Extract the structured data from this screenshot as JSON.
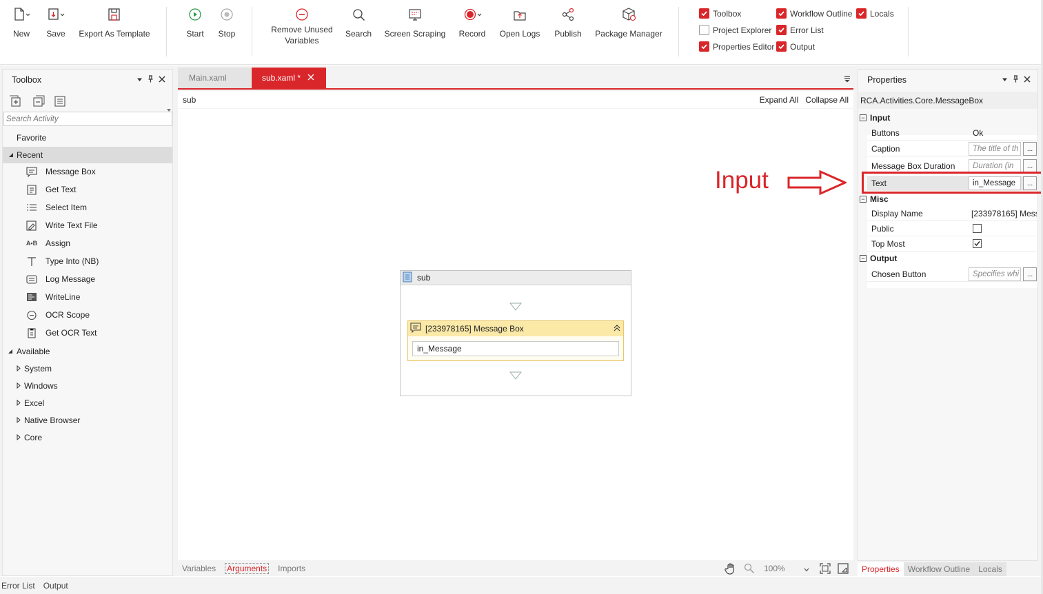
{
  "ribbon": {
    "new_label": "New",
    "save_label": "Save",
    "export_label": "Export As Template",
    "start_label": "Start",
    "stop_label": "Stop",
    "remove_unused_label_1": "Remove Unused",
    "remove_unused_label_2": "Variables",
    "search_label": "Search",
    "screen_scraping_label": "Screen Scraping",
    "record_label": "Record",
    "open_logs_label": "Open Logs",
    "publish_label": "Publish",
    "package_manager_label": "Package Manager",
    "checks": {
      "toolbox": {
        "label": "Toolbox",
        "checked": true
      },
      "workflow_outline": {
        "label": "Workflow Outline",
        "checked": true
      },
      "locals": {
        "label": "Locals",
        "checked": true
      },
      "project_explorer": {
        "label": "Project Explorer",
        "checked": false
      },
      "error_list": {
        "label": "Error List",
        "checked": true
      },
      "properties_editor": {
        "label": "Properties Editor",
        "checked": true
      },
      "output": {
        "label": "Output",
        "checked": true
      }
    }
  },
  "toolbox": {
    "title": "Toolbox",
    "search_placeholder": "Search Activity",
    "favorite": "Favorite",
    "recent": "Recent",
    "recent_items": [
      "Message Box",
      "Get Text",
      "Select Item",
      "Write Text File",
      "Assign",
      "Type Into (NB)",
      "Log Message",
      "WriteLine",
      "OCR Scope",
      "Get OCR Text"
    ],
    "available": "Available",
    "available_items": [
      "System",
      "Windows",
      "Excel",
      "Native Browser",
      "Core"
    ]
  },
  "tabs": [
    {
      "label": "Main.xaml",
      "active": false
    },
    {
      "label": "sub.xaml *",
      "active": true
    }
  ],
  "designer": {
    "breadcrumb": "sub",
    "expand_all": "Expand All",
    "collapse_all": "Collapse All",
    "sequence_title": "sub",
    "activity_title": "[233978165] Message Box",
    "activity_value": "in_Message",
    "annotation": "Input",
    "bottom_tabs": [
      "Variables",
      "Arguments",
      "Imports"
    ],
    "zoom": "100%"
  },
  "properties": {
    "title": "Properties",
    "type_name": "RCA.Activities.Core.MessageBox",
    "sections": {
      "input": "Input",
      "misc": "Misc",
      "output": "Output"
    },
    "rows": {
      "buttons": {
        "name": "Buttons",
        "value": "Ok"
      },
      "caption": {
        "name": "Caption",
        "placeholder": "The title of th"
      },
      "duration": {
        "name": "Message Box Duration",
        "placeholder": "Duration (in"
      },
      "text": {
        "name": "Text",
        "value": "in_Message"
      },
      "display_name": {
        "name": "Display Name",
        "value": "[233978165] Mess"
      },
      "public": {
        "name": "Public",
        "checked": false
      },
      "top_most": {
        "name": "Top Most",
        "checked": true
      },
      "chosen_button": {
        "name": "Chosen Button",
        "placeholder": "Specifies whi"
      }
    },
    "bottom_tabs": [
      "Properties",
      "Workflow Outline",
      "Locals"
    ]
  },
  "footer_tabs": [
    "Error List",
    "Output"
  ],
  "colors": {
    "accent": "#d9262b",
    "activity_header": "#fbe9a8",
    "panel_bg": "#f5f5f5"
  }
}
